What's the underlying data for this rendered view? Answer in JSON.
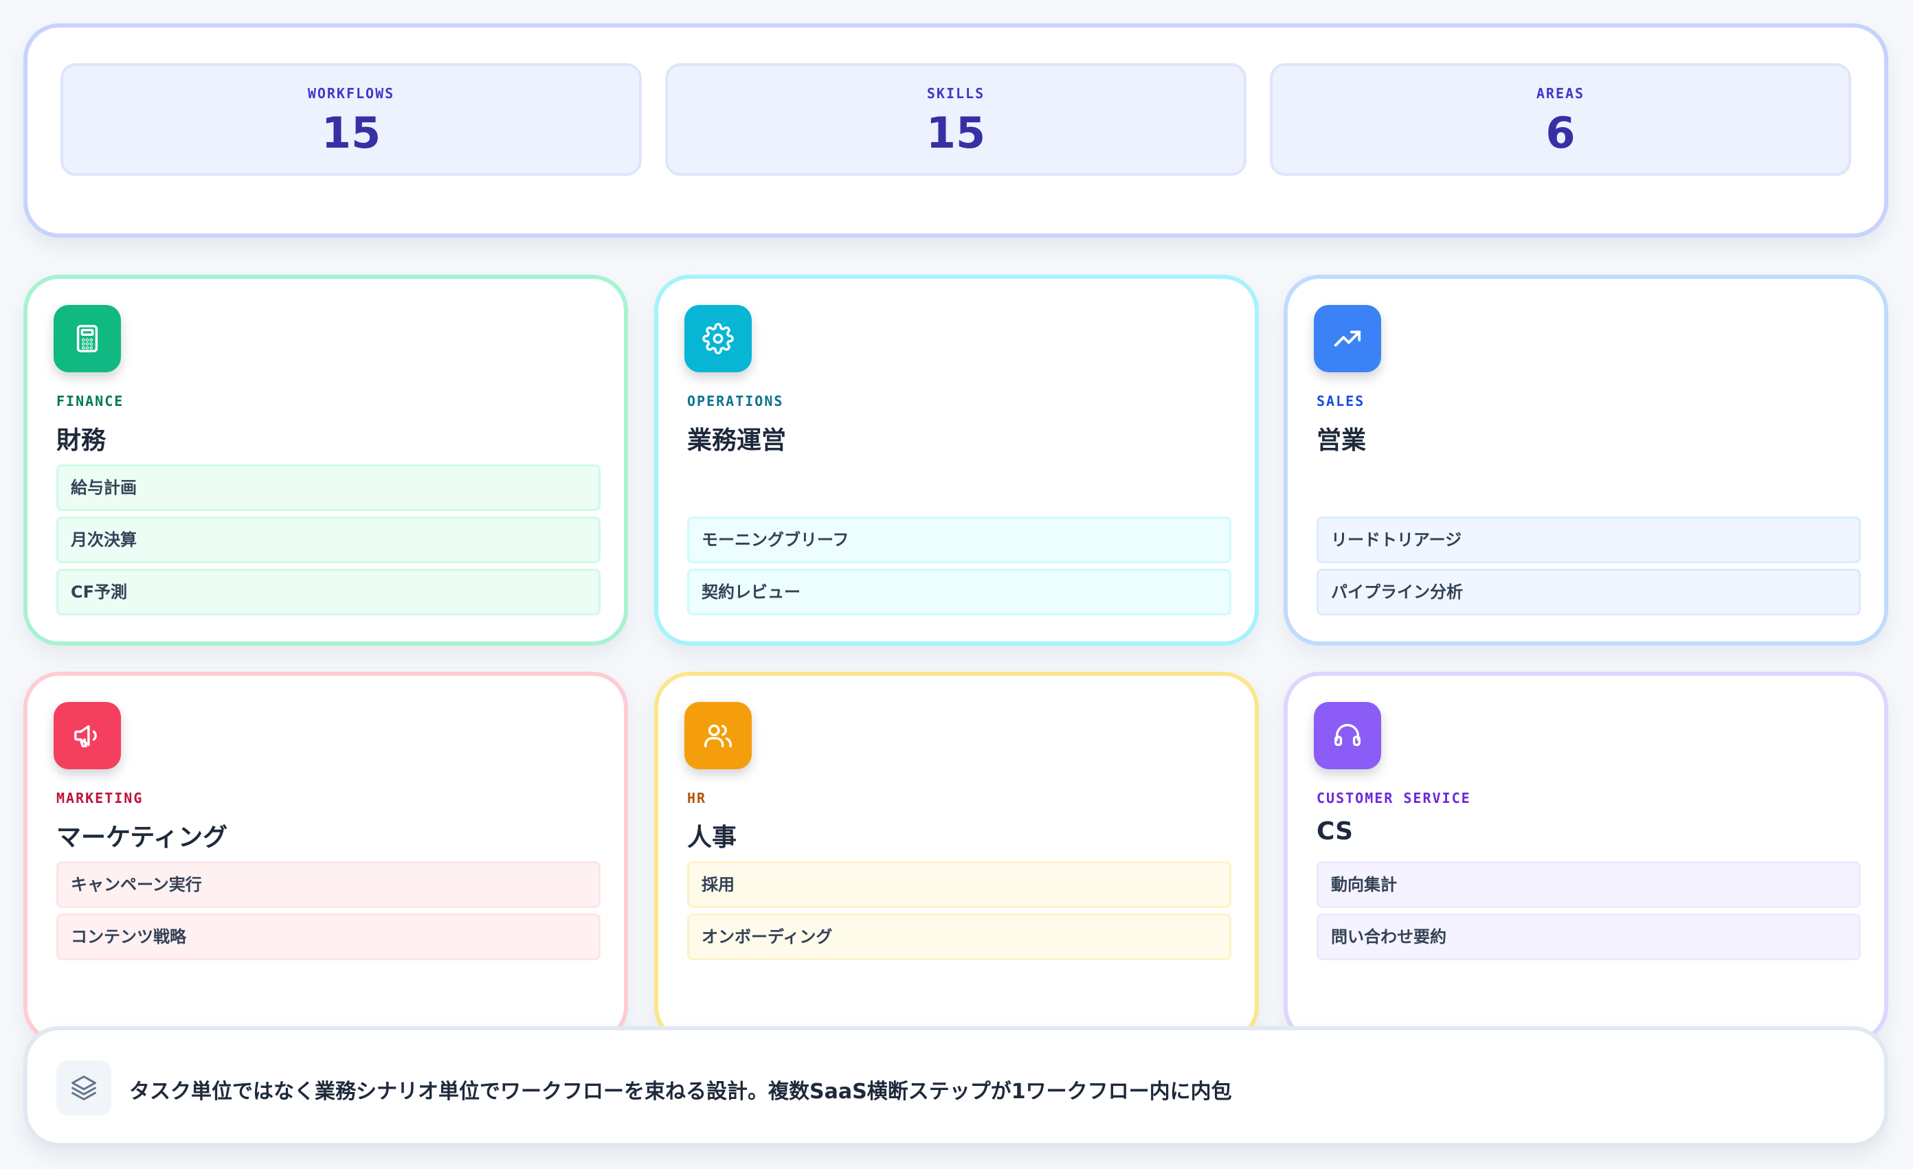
{
  "stats": [
    {
      "label": "WORKFLOWS",
      "value": "15"
    },
    {
      "label": "SKILLS",
      "value": "15"
    },
    {
      "label": "AREAS",
      "value": "6"
    }
  ],
  "areas": [
    {
      "tag": "FINANCE",
      "title": "財務",
      "icon": "calculator-icon",
      "accent": "#10b981",
      "tag_color": "#047857",
      "items": [
        "給与計画",
        "月次決算",
        "CF予測"
      ]
    },
    {
      "tag": "OPERATIONS",
      "title": "業務運営",
      "icon": "gear-icon",
      "accent": "#06b6d4",
      "tag_color": "#0e7490",
      "items": [
        "モーニングブリーフ",
        "契約レビュー"
      ]
    },
    {
      "tag": "SALES",
      "title": "営業",
      "icon": "trending-up-icon",
      "accent": "#3b82f6",
      "tag_color": "#1d4ed8",
      "items": [
        "リードトリアージ",
        "パイプライン分析"
      ]
    },
    {
      "tag": "MARKETING",
      "title": "マーケティング",
      "icon": "megaphone-icon",
      "accent": "#f43f5e",
      "tag_color": "#be123c",
      "items": [
        "キャンペーン実行",
        "コンテンツ戦略"
      ]
    },
    {
      "tag": "HR",
      "title": "人事",
      "icon": "users-icon",
      "accent": "#f59e0b",
      "tag_color": "#b45309",
      "items": [
        "採用",
        "オンボーディング"
      ]
    },
    {
      "tag": "CUSTOMER SERVICE",
      "title": "CS",
      "icon": "headset-icon",
      "accent": "#8b5cf6",
      "tag_color": "#6d28d9",
      "items": [
        "動向集計",
        "問い合わせ要約"
      ]
    }
  ],
  "footer": {
    "icon": "layers-icon",
    "text": "タスク単位ではなく業務シナリオ単位でワークフローを束ねる設計。複数SaaS横断ステップが1ワークフロー内に内包"
  }
}
